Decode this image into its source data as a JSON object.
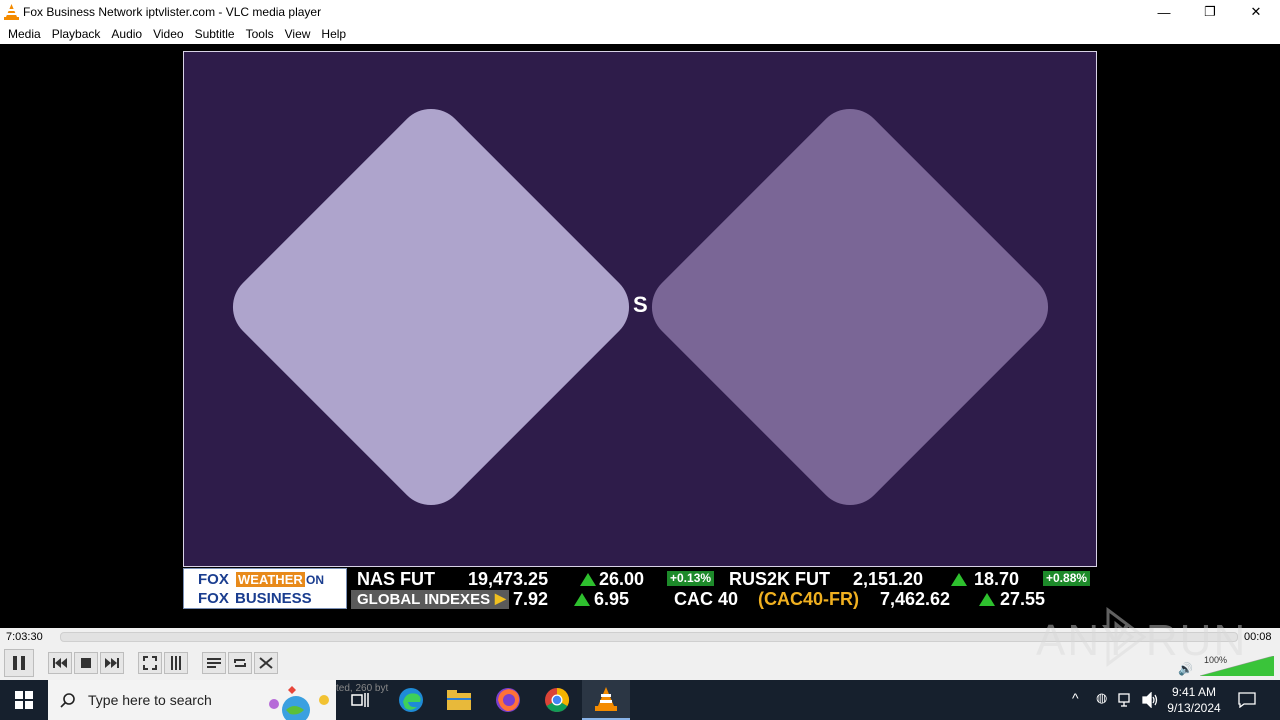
{
  "window": {
    "title": "Fox Business Network iptvlister.com - VLC media player",
    "minimize": "—",
    "maximize": "❐",
    "close": "✕"
  },
  "menu": [
    "Media",
    "Playback",
    "Audio",
    "Video",
    "Subtitle",
    "Tools",
    "View",
    "Help"
  ],
  "video": {
    "mid_glyph": "S",
    "diamond_colors": [
      "#aea4cc",
      "#7a6696"
    ],
    "ticker": {
      "logo_top_fox": "FOX",
      "logo_top_weather": "WEATHER",
      "logo_top_on": "ON",
      "logo_bottom_fox": "FOX",
      "logo_bottom_business": "BUSINESS",
      "row1": [
        {
          "label": "NAS FUT",
          "value": "19,473.25",
          "change": "26.00",
          "pct": "+0.13%"
        },
        {
          "label": "RUS2K FUT",
          "value": "2,151.20",
          "change": "18.70",
          "pct": "+0.88%"
        }
      ],
      "row2": {
        "section": "GLOBAL INDEXES",
        "lead_value": "7.92",
        "lead_change": "6.95",
        "index_label": "CAC 40",
        "index_code": "(CAC40-FR)",
        "index_value": "7,462.62",
        "index_change": "27.55"
      }
    }
  },
  "controls": {
    "elapsed": "7:03:30",
    "remaining": "00:08",
    "volume": "100%",
    "volume_level": 1.0,
    "status_text": "ted, 260 byt"
  },
  "taskbar": {
    "search_placeholder": "Type here to search",
    "time": "9:41 AM",
    "date": "9/13/2024"
  },
  "watermark": "ANY RUN"
}
